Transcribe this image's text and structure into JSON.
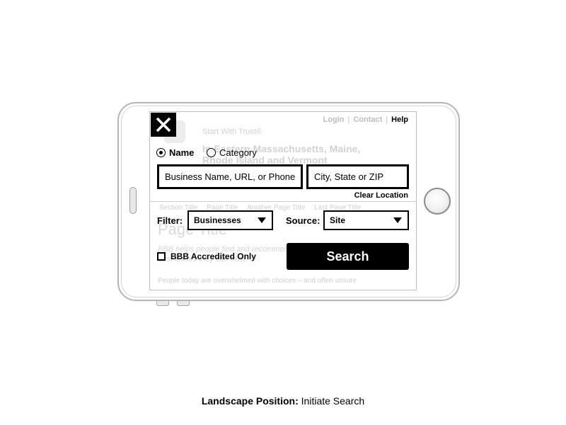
{
  "background_page": {
    "nav": {
      "login": "Login",
      "contact": "Contact",
      "help": "Help",
      "separator": "|"
    },
    "tagline": "Start With Trust®",
    "region": "In Eastern Massachusetts, Maine, Rhode Island and Vermont",
    "breadcrumbs": [
      "Section Title",
      "Page Title",
      "Another Page Title",
      "Last Page Title"
    ],
    "page_title": "Page Title",
    "intro": "BBB helps people find and recommend businesses they can trust.",
    "body_snippet": "People today are overwhelmed with choices – and often unsure"
  },
  "search_panel": {
    "close_icon": "close-icon",
    "search_type": {
      "options": [
        {
          "label": "Name",
          "selected": true
        },
        {
          "label": "Category",
          "selected": false
        }
      ]
    },
    "business_input": {
      "placeholder": "Business Name, URL, or Phone",
      "value": ""
    },
    "location_input": {
      "placeholder": "City, State or ZIP",
      "value": ""
    },
    "clear_location": "Clear Location",
    "filter": {
      "label": "Filter:",
      "selected": "Businesses"
    },
    "source": {
      "label": "Source:",
      "selected": "Site"
    },
    "accredited_only": {
      "label": "BBB Accredited Only",
      "checked": false
    },
    "search_button": "Search"
  },
  "caption": {
    "bold": "Landscape Position:",
    "text": " Initiate Search"
  }
}
